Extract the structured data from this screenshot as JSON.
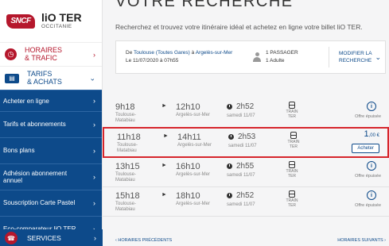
{
  "brand": {
    "badge": "SNCF",
    "title": "liO TER",
    "subtitle": "OCCITANIE"
  },
  "sidebar": {
    "horaires": {
      "line1": "HORAIRES",
      "line2": "& TRAFIC",
      "arrow": "›"
    },
    "tarifs": {
      "line1": "TARIFS",
      "line2": "& ACHATS",
      "arrow": "⌄"
    },
    "items": [
      {
        "label": "Acheter en ligne",
        "arrow": "›"
      },
      {
        "label": "Tarifs et abonnements",
        "arrow": "›"
      },
      {
        "label": "Bons plans",
        "arrow": "›"
      },
      {
        "label": "Adhésion abonnement annuel",
        "arrow": "›"
      },
      {
        "label": "Souscription Carte Pastel",
        "arrow": "›"
      },
      {
        "label": "Eco-comparateur liO TER",
        "arrow": "›"
      }
    ],
    "services": {
      "label": "SERVICES",
      "arrow": "›"
    }
  },
  "page": {
    "heading": "VOTRE RECHERCHE",
    "intro": "Recherchez et trouvez votre itinéraire idéal et achetez en ligne votre billet liO TER."
  },
  "summary": {
    "from": "Toulouse (Toutes Gares)",
    "sep": " à ",
    "to": "Argelès-sur-Mer",
    "prefix": "De ",
    "date": "Le 11/07/2020 à 07h55",
    "passengers": "1 PASSAGER",
    "adult": "1 Adulte",
    "modify_line1": "MODIFIER LA",
    "modify_line2": "RECHERCHE"
  },
  "results": [
    {
      "dep_time": "9h18",
      "dep_station1": "Toulouse-",
      "dep_station2": "Matabiau",
      "arr_time": "12h10",
      "arr_station": "Argelès-sur-Mer",
      "duration": "2h52",
      "date": "samedi 11/07",
      "mode1": "TRAIN",
      "mode2": "TER",
      "status": "Offre épuisée"
    },
    {
      "dep_time": "11h18",
      "dep_station1": "Toulouse-",
      "dep_station2": "Matabiau",
      "arr_time": "14h11",
      "arr_station": "Argelès-sur-Mer",
      "duration": "2h53",
      "date": "samedi 11/07",
      "mode1": "TRAIN",
      "mode2": "TER",
      "price_int": "1",
      "price_dec": ",00 €",
      "buy": "Acheter"
    },
    {
      "dep_time": "13h15",
      "dep_station1": "Toulouse-",
      "dep_station2": "Matabiau",
      "arr_time": "16h10",
      "arr_station": "Argelès-sur-Mer",
      "duration": "2h55",
      "date": "samedi 11/07",
      "mode1": "TRAIN",
      "mode2": "TER",
      "status": "Offre épuisée"
    },
    {
      "dep_time": "15h18",
      "dep_station1": "Toulouse-",
      "dep_station2": "Matabiau",
      "arr_time": "18h10",
      "arr_station": "Argelès-sur-Mer",
      "duration": "2h52",
      "date": "samedi 11/07",
      "mode1": "TRAIN",
      "mode2": "TER",
      "status": "Offre épuisée"
    }
  ],
  "pager": {
    "prev": "HORAIRES PRÉCÉDENTS",
    "next": "HORAIRES SUIVANTS"
  },
  "colors": {
    "brand_red": "#b5172c",
    "brand_blue": "#0d4a8a",
    "highlight": "#d6252c"
  },
  "icons": {
    "horaires": "clock-icon",
    "tarifs": "ticket-icon",
    "duration": "clock-icon",
    "mode": "train-icon",
    "info": "info-icon",
    "passenger": "person-icon"
  }
}
